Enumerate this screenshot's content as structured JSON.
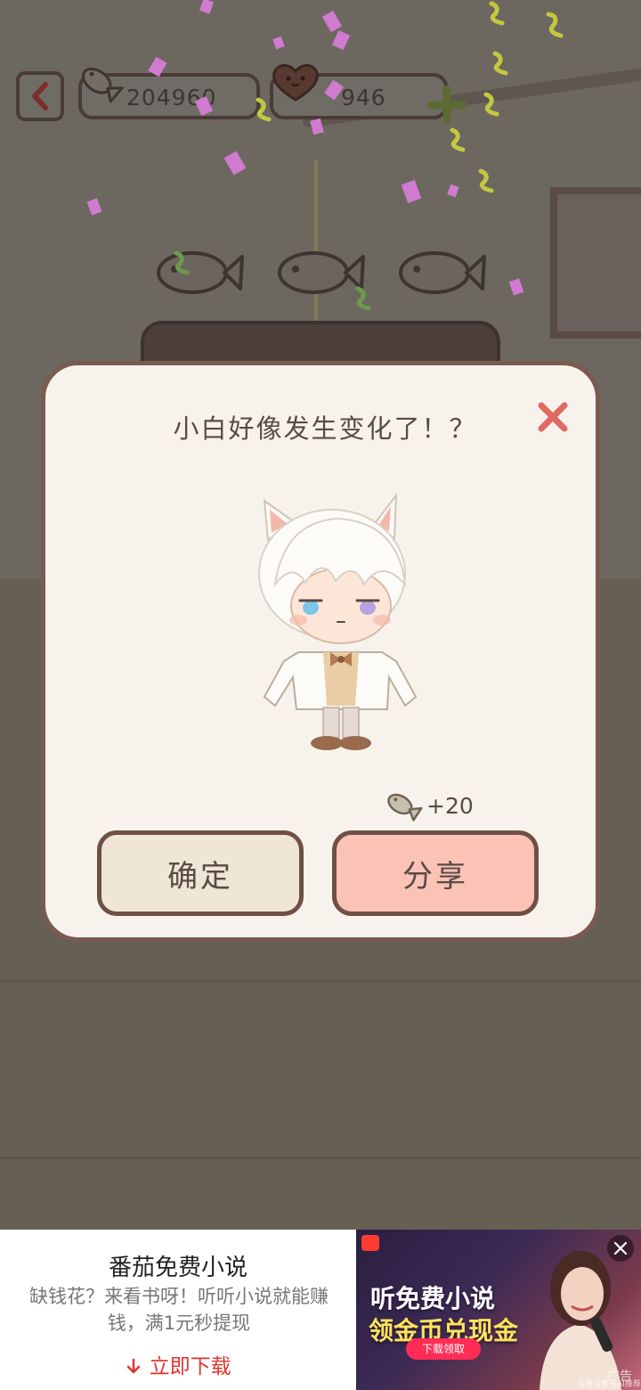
{
  "hud": {
    "fish_count": "204960",
    "heart_count": "946"
  },
  "dialog": {
    "title": "小白好像发生变化了！？",
    "reward": "+20",
    "confirm_label": "确定",
    "share_label": "分享"
  },
  "ad": {
    "app_name": "番茄免费小说",
    "description": "缺钱花？来看书呀！听听小说就能赚钱，满1元秒提现",
    "download_label": "立即下载",
    "headline_1": "听免费小说",
    "headline_2": "领金币兑现金",
    "cta": "下载领取",
    "tag": "广告",
    "source": "百度百家号AI推荐"
  },
  "colors": {
    "dialog_bg": "#f7f3ec",
    "dialog_border": "#7b5a4f",
    "confirm_bg": "#efe6d6",
    "share_bg": "#fbc2b6",
    "close_x": "#e06a62",
    "download_red": "#e3342f"
  }
}
